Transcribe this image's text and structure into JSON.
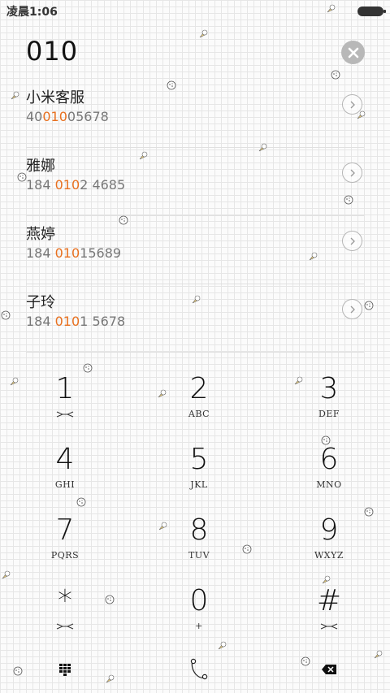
{
  "status_bar": {
    "time": "凌晨1:06"
  },
  "dial_input": {
    "number": "010"
  },
  "results": [
    {
      "name": "小米客服",
      "number_pre": "40",
      "number_match": "010",
      "number_post": "05678"
    },
    {
      "name": "雅娜",
      "number_pre": "184 ",
      "number_match": "010",
      "number_post": "2 4685"
    },
    {
      "name": "燕婷",
      "number_pre": "184 ",
      "number_match": "010",
      "number_post": "15689"
    },
    {
      "name": "子玲",
      "number_pre": "184 ",
      "number_match": "010",
      "number_post": "1 5678"
    }
  ],
  "keypad": {
    "k1": {
      "digit": "1",
      "letters": ""
    },
    "k2": {
      "digit": "2",
      "letters": "ABC"
    },
    "k3": {
      "digit": "3",
      "letters": "DEF"
    },
    "k4": {
      "digit": "4",
      "letters": "GHI"
    },
    "k5": {
      "digit": "5",
      "letters": "JKL"
    },
    "k6": {
      "digit": "6",
      "letters": "MNO"
    },
    "k7": {
      "digit": "7",
      "letters": "PQRS"
    },
    "k8": {
      "digit": "8",
      "letters": "TUV"
    },
    "k9": {
      "digit": "9",
      "letters": "WXYZ"
    },
    "kstar": {
      "digit": "*",
      "letters": ""
    },
    "k0": {
      "digit": "0",
      "letters": "+"
    },
    "khash": {
      "digit": "#",
      "letters": ""
    }
  },
  "icons": {
    "clear": "close-icon",
    "detail": "chevron-right-icon",
    "keypad_toggle": "dialpad-icon",
    "call": "phone-icon",
    "backspace": "backspace-icon"
  },
  "colors": {
    "highlight": "#e8701f",
    "text": "#222222",
    "subtext": "#777777"
  }
}
